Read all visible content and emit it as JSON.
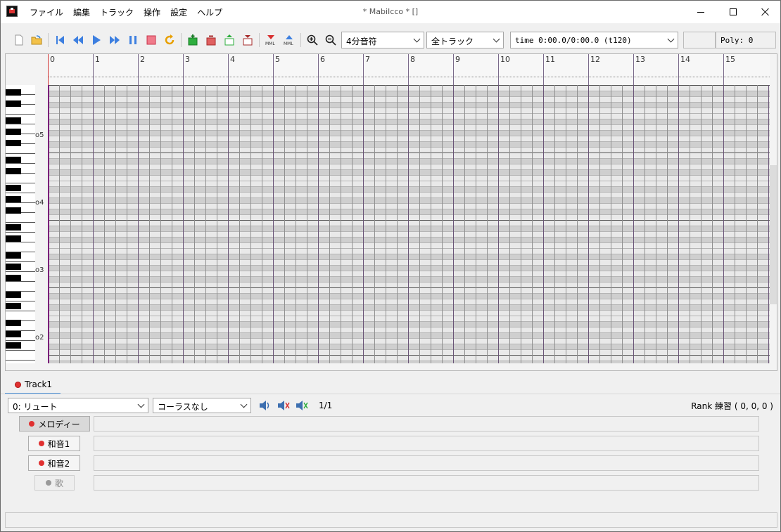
{
  "window": {
    "title": "* MabiIcco *  []"
  },
  "menu": [
    "ファイル",
    "編集",
    "トラック",
    "操作",
    "設定",
    "ヘルプ"
  ],
  "toolbar": {
    "icons": [
      "new-file-icon",
      "open-folder-icon",
      "skip-to-start-icon",
      "rewind-icon",
      "play-icon",
      "fast-forward-icon",
      "pause-icon",
      "stop-icon",
      "loop-icon",
      "add-track-icon",
      "remove-track-icon",
      "track-up-icon",
      "track-down-icon",
      "mml-import-icon",
      "mml-export-icon",
      "zoom-in-icon",
      "zoom-out-icon"
    ],
    "note_length": "4分音符",
    "track_filter": "全トラック",
    "time": "time 0:00.0/0:00.0 (t120)",
    "poly": "Poly: 0"
  },
  "piano_roll": {
    "measures": [
      "0",
      "1",
      "2",
      "3",
      "4",
      "5",
      "6",
      "7",
      "8",
      "9",
      "10",
      "11",
      "12",
      "13",
      "14",
      "15"
    ],
    "octaves": [
      "o5",
      "o4",
      "o3",
      "o2"
    ]
  },
  "tracks": [
    {
      "name": "Track1",
      "color": "#e03030"
    }
  ],
  "track_settings": {
    "instrument": "0: リュート",
    "chorus": "コーラスなし",
    "page": "1/1",
    "rank": "Rank 練習 ( 0, 0, 0 )"
  },
  "parts": [
    {
      "label": "メロディー",
      "state": "active"
    },
    {
      "label": "和音1",
      "state": "normal"
    },
    {
      "label": "和音2",
      "state": "normal"
    },
    {
      "label": "歌",
      "state": "disabled"
    }
  ],
  "colors": {
    "accent": "#4a90d9",
    "track_red": "#e03030",
    "playhead": "#7a1f7a"
  }
}
